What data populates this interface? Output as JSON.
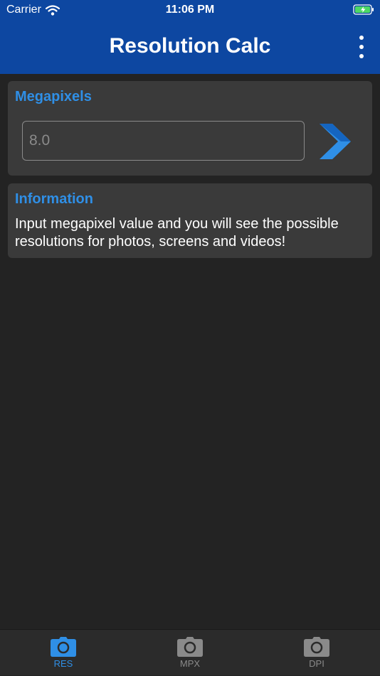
{
  "status_bar": {
    "carrier": "Carrier",
    "time": "11:06 PM"
  },
  "app_bar": {
    "title": "Resolution Calc"
  },
  "megapixels_card": {
    "title": "Megapixels",
    "input_placeholder": "8.0",
    "input_value": ""
  },
  "info_card": {
    "title": "Information",
    "text": "Input megapixel value and you will see the possible resolutions for photos, screens and videos!"
  },
  "tabs": [
    {
      "label": "RES",
      "icon": "camera-icon",
      "active": true
    },
    {
      "label": "MPX",
      "icon": "camera-icon",
      "active": false
    },
    {
      "label": "DPI",
      "icon": "camera-icon",
      "active": false
    }
  ],
  "colors": {
    "primary": "#0d47a1",
    "accent": "#2f8fe6",
    "background": "#232323",
    "card": "#3a3a3a",
    "inactive": "#8a8a8a"
  }
}
